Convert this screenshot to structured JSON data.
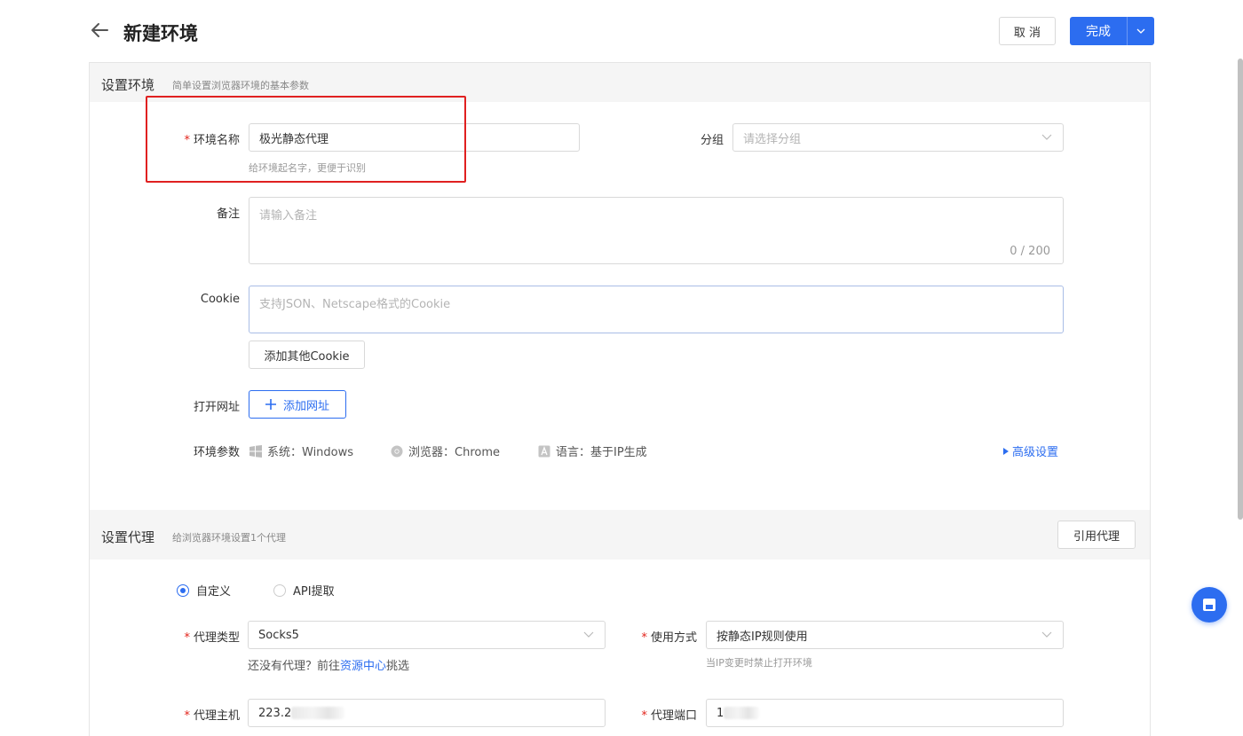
{
  "header": {
    "title": "新建环境",
    "cancel_label": "取 消",
    "done_label": "完成"
  },
  "env_section": {
    "title": "设置环境",
    "desc": "简单设置浏览器环境的基本参数",
    "name_label": "环境名称",
    "name_value": "极光静态代理",
    "name_hint": "给环境起名字，更便于识别",
    "group_label": "分组",
    "group_placeholder": "请选择分组",
    "remark_label": "备注",
    "remark_placeholder": "请输入备注",
    "remark_counter": "0 / 200",
    "cookie_label": "Cookie",
    "cookie_placeholder": "支持JSON、Netscape格式的Cookie",
    "add_cookie_label": "添加其他Cookie",
    "url_label": "打开网址",
    "add_url_label": "添加网址",
    "params_label": "环境参数",
    "param_os": "系统：Windows",
    "param_browser": "浏览器：Chrome",
    "param_lang": "语言：基于IP生成",
    "advanced_label": "高级设置"
  },
  "proxy_section": {
    "title": "设置代理",
    "desc": "给浏览器环境设置1个代理",
    "cite_label": "引用代理",
    "radio_custom": "自定义",
    "radio_api": "API提取",
    "type_label": "代理类型",
    "type_value": "Socks5",
    "type_hint_prefix": "还没有代理？前往",
    "type_hint_link": "资源中心",
    "type_hint_suffix": "挑选",
    "usage_label": "使用方式",
    "usage_value": "按静态IP规则使用",
    "usage_hint": "当IP变更时禁止打开环境",
    "host_label": "代理主机",
    "host_value": "223.2",
    "port_label": "代理端口",
    "port_value": "1"
  },
  "colors": {
    "accent": "#2c6df0",
    "required": "#e2231a",
    "highlight": "#e02020"
  }
}
